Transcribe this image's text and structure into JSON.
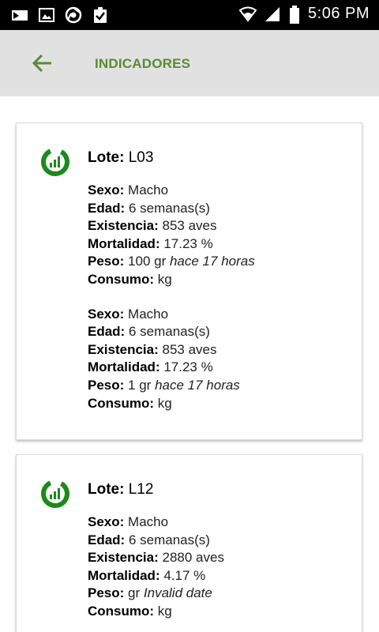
{
  "status_bar": {
    "time": "5:06 PM",
    "left_icons": [
      "sim-card-icon",
      "image-icon",
      "chrome-icon",
      "clipboard-check-icon"
    ],
    "right_icons": [
      "wifi-icon",
      "signal-icon",
      "battery-icon"
    ]
  },
  "app_bar": {
    "title": "INDICADORES",
    "back_icon": "arrow-left-icon",
    "accent_color": "#5a8a34"
  },
  "labels": {
    "lote": "Lote:",
    "sexo": "Sexo:",
    "edad": "Edad:",
    "existencia": "Existencia:",
    "mortalidad": "Mortalidad:",
    "peso": "Peso:",
    "consumo": "Consumo:"
  },
  "cards": [
    {
      "lote": "L03",
      "icon": "chart-donut-icon",
      "groups": [
        {
          "sexo": "Macho",
          "edad": "6 semanas(s)",
          "existencia": "853 aves",
          "mortalidad": "17.23 %",
          "peso_value": "100 gr",
          "peso_note": "hace 17 horas",
          "consumo": "kg"
        },
        {
          "sexo": "Macho",
          "edad": "6 semanas(s)",
          "existencia": "853 aves",
          "mortalidad": "17.23 %",
          "peso_value": "1 gr",
          "peso_note": "hace 17 horas",
          "consumo": "kg"
        }
      ]
    },
    {
      "lote": "L12",
      "icon": "chart-donut-icon",
      "groups": [
        {
          "sexo": "Macho",
          "edad": "6 semanas(s)",
          "existencia": "2880 aves",
          "mortalidad": "4.17 %",
          "peso_value": "gr",
          "peso_note": "Invalid date",
          "consumo": "kg"
        }
      ]
    }
  ]
}
